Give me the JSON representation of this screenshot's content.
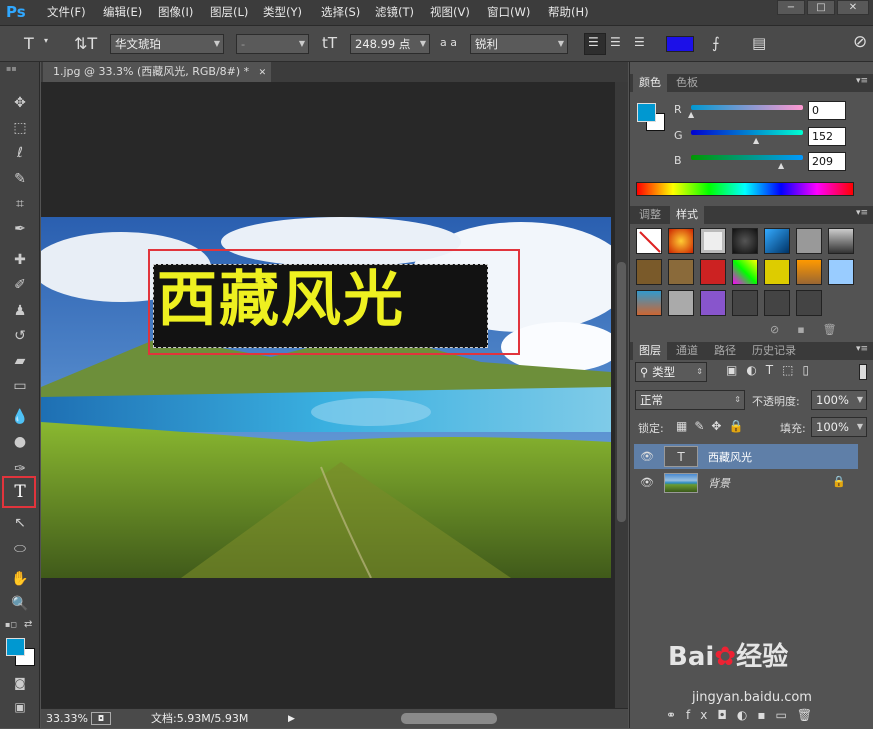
{
  "app": {
    "logo": "Ps"
  },
  "menu": [
    "文件(F)",
    "编辑(E)",
    "图像(I)",
    "图层(L)",
    "类型(Y)",
    "选择(S)",
    "滤镜(T)",
    "视图(V)",
    "窗口(W)",
    "帮助(H)"
  ],
  "options": {
    "font_family": "华文琥珀",
    "font_style": "-",
    "font_size": "248.99 点",
    "aa_label": "a a",
    "antialias": "锐利",
    "color": "#1c10e8"
  },
  "document": {
    "tab_title": "1.jpg @ 33.3% (西藏风光, RGB/8#) *",
    "text": "西藏风光"
  },
  "status": {
    "zoom": "33.33%",
    "doc_label": "文档:5.93M/5.93M"
  },
  "color_panel": {
    "tabs": [
      "颜色",
      "色板"
    ],
    "r": "0",
    "g": "152",
    "b": "209",
    "r_label": "R",
    "g_label": "G",
    "b_label": "B",
    "fg": "#0098d1"
  },
  "styles_panel": {
    "tabs": [
      "调整",
      "样式"
    ]
  },
  "layers_panel": {
    "tabs": [
      "图层",
      "通道",
      "路径",
      "历史记录"
    ],
    "kind": "类型",
    "blend": "正常",
    "opacity_label": "不透明度:",
    "opacity": "100%",
    "lock_label": "锁定:",
    "fill_label": "填充:",
    "fill": "100%",
    "layers": [
      {
        "name": "西藏风光",
        "type": "text"
      },
      {
        "name": "背景",
        "type": "image"
      }
    ]
  },
  "watermark": {
    "brand": "Bai",
    "brand2": "经验",
    "url": "jingyan.baidu.com"
  }
}
